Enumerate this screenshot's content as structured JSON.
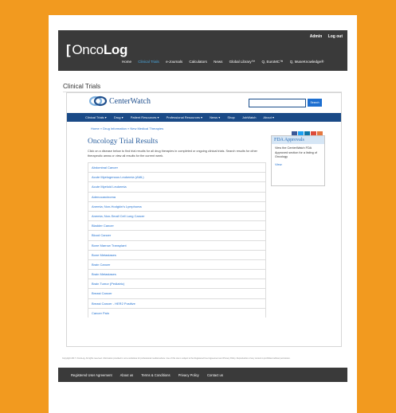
{
  "header": {
    "logo_bracket": "[",
    "logo_onco": "Onco",
    "logo_log": "Log",
    "top_links": [
      "Admin",
      "Log out"
    ],
    "nav": [
      "Home",
      "Clinical Trials",
      "e-Journals",
      "Calculators",
      "News",
      "Global Library™",
      "Q, EuroMC™",
      "Q, MuseKnowledge®"
    ],
    "active_nav": "Clinical Trials"
  },
  "page_title": "Clinical Trials",
  "centerwatch": {
    "logo_text": "CenterWatch",
    "search_button": "Search",
    "search_placeholder": "",
    "nav": [
      "Clinical Trials ▾",
      "Drug ▾",
      "Patient Resources ▾",
      "Professional Resources ▾",
      "News ▾",
      "Shop",
      "JobWatch",
      "About ▾"
    ],
    "breadcrumb": "Home » Drug Information » New Medical Therapies",
    "title": "Oncology Trial Results",
    "description": "Click on a disease below to find trial results for all drug therapies in completed or ongoing clinical trials. Search results for other therapeutic areas or view all results for the current week.",
    "diseases": [
      "Abdominal Cancer",
      "Acute Myelogenous Leukemia (AML)",
      "Acute Myeloid Leukemia",
      "Adenocarcinoma",
      "Anemia; Non-Hodgkin's Lymphoma",
      "Anemia; Non-Small Cell Lung Cancer",
      "Bladder Cancer",
      "Blood Cancer",
      "Bone Marrow Transplant",
      "Bone Metastases",
      "Brain Cancer",
      "Brain Metastases",
      "Brain Tumor (Pediatric)",
      "Breast Cancer",
      "Breast Cancer - HER2 Positive",
      "Cancer Pain"
    ],
    "fda": {
      "title": "FDA Approvals",
      "body": "View the CenterWatch FDA Approved section for a listing of Oncology",
      "link": "View"
    },
    "share_colors": [
      "#3b5998",
      "#1da1f2",
      "#0e76a8",
      "#dd4b39",
      "#e5773f"
    ]
  },
  "fineprint": "Copyright 2017. OncoLog. All rights reserved. Information provided is not a substitute for professional medical advice. Use of this site is subject to the Registered User Agreement and Privacy Policy. Reproduction of any content is prohibited without permission.",
  "footer": [
    "Registered User Agreement",
    "About us",
    "Terms & Conditions",
    "Privacy Policy",
    "Contact us"
  ],
  "colors": {
    "background": "#f29a1f",
    "header_bg": "#3a3a3a",
    "cw_nav": "#1a4a87",
    "link": "#1e6fd0"
  }
}
